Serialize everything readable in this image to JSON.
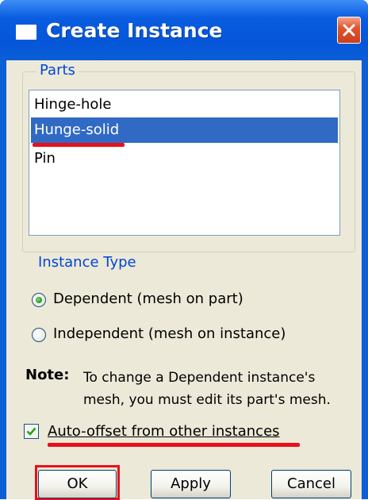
{
  "window": {
    "title": "Create Instance",
    "close_icon": "close-x-icon",
    "title_icon": "window-icon"
  },
  "parts": {
    "group_title": "Parts",
    "items": [
      "Hinge-hole",
      "Hunge-solid",
      "Pin"
    ],
    "selected": "Hunge-solid"
  },
  "instance_type": {
    "title": "Instance Type",
    "options": [
      {
        "label": "Dependent (mesh on part)",
        "selected": true
      },
      {
        "label": "Independent (mesh on instance)",
        "selected": false
      }
    ]
  },
  "note": {
    "label": "Note:",
    "line1": "To change a Dependent instance's",
    "line2": "mesh, you must edit its part's mesh."
  },
  "auto_offset": {
    "label": "Auto-offset from other instances",
    "checked": true
  },
  "buttons": {
    "ok": "OK",
    "apply": "Apply",
    "cancel": "Cancel"
  },
  "colors": {
    "titlebar": "#0a5fd6",
    "selection": "#316ac5",
    "annotation_red": "#e8101a",
    "dialog_bg": "#ece9d8"
  }
}
